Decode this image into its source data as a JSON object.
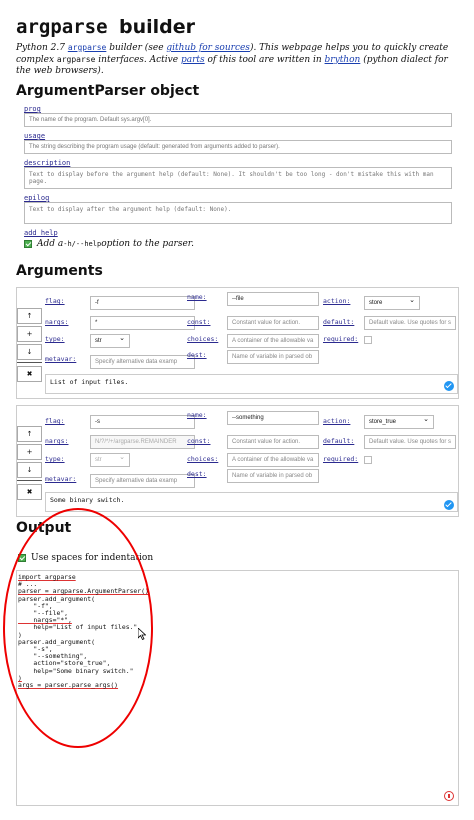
{
  "title_mono": "argparse",
  "title_bold": "builder",
  "intro": {
    "p1": "Python 2.7 ",
    "argparse_link": "argparse",
    "p2": " builder (see ",
    "github_link": "github for sources",
    "p3": "). This webpage helps you to quickly create complex ",
    "argparse_code": "argparse",
    "p4": " interfaces. Active ",
    "parts_link": "parts",
    "p5": " of this tool are written in ",
    "brython_link": "brython",
    "p6": " (python dialect for the web browsers)."
  },
  "parser_section": {
    "heading": "ArgumentParser object",
    "prog_label": "prog",
    "prog_placeholder": "The name of the program. Default sys.argv[0].",
    "usage_label": "usage",
    "usage_placeholder": "The string describing the program usage (default: generated from arguments added to parser).",
    "description_label": "description",
    "description_placeholder": "Text to display before the argument help (default: None). It shouldn't be too long - don't mistake this with man page.",
    "epilog_label": "epilog",
    "epilog_placeholder": "Text to display after the argument help (default: None).",
    "add_help_label": "add_help",
    "add_help_text_1": "Add a ",
    "add_help_code": "-h/--help",
    "add_help_text_2": " option to the parser."
  },
  "arguments_heading": "Arguments",
  "arg_labels": {
    "flag": "flag:",
    "name": "name:",
    "action": "action:",
    "nargs": "nargs:",
    "const": "const:",
    "default": "default:",
    "type": "type:",
    "choices": "choices:",
    "required": "required:",
    "metavar": "metavar:",
    "dest": "dest:"
  },
  "side_buttons": {
    "up": "↑",
    "add": "+",
    "down": "↓",
    "delete": "✖"
  },
  "arguments": [
    {
      "flag": "-f",
      "name": "--file",
      "action": "store",
      "nargs": "*",
      "const_placeholder": "Constant value for action.",
      "default_placeholder": "Default value. Use quotes for s",
      "type": "str",
      "choices_placeholder": "A container of the allowable va",
      "metavar_placeholder": "Specify alternative data examp",
      "dest_placeholder": "Name of variable in parsed ob",
      "help": "List of input files."
    },
    {
      "flag": "-s",
      "name": "--something",
      "action": "store_true",
      "nargs_placeholder": "N/?/*/+/argparse.REMAINDER",
      "const_placeholder": "Constant value for action.",
      "default_placeholder": "Default value. Use quotes for s",
      "type": "str",
      "choices_placeholder": "A container of the allowable va",
      "metavar_placeholder": "Specify alternative data examp",
      "dest_placeholder": "Name of variable in parsed ob",
      "help": "Some binary switch."
    }
  ],
  "output": {
    "heading": "Output",
    "spaces_label": "Use spaces for indentation",
    "code_lines": [
      "import argparse",
      "",
      "# ...",
      "parser = argparse.ArgumentParser()",
      "parser.add_argument(",
      "    \"-f\",",
      "    \"--file\",",
      "    nargs=\"*\",",
      "    help=\"List of input files.\"",
      ")",
      "parser.add_argument(",
      "    \"-s\",",
      "    \"--something\",",
      "    action=\"store_true\",",
      "    help=\"Some binary switch.\"",
      ")",
      "",
      "args = parser.parse_args()"
    ]
  },
  "colors": {
    "link": "#1a3fb0",
    "label": "#2b2a8f",
    "check": "#4caf50",
    "annotation": "#e00000"
  }
}
